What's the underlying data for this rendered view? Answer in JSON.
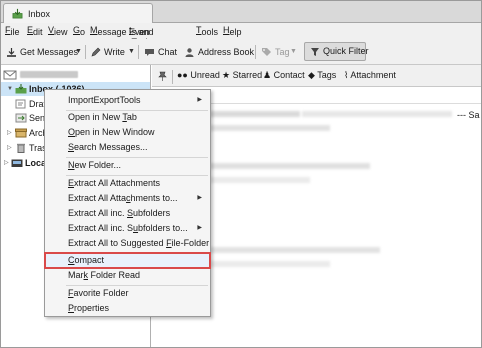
{
  "window": {
    "tab_title": "Inbox",
    "icon": "thunderbird-inbox-icon"
  },
  "menubar": {
    "items": [
      {
        "pre": "",
        "key": "F",
        "post": "ile"
      },
      {
        "pre": "",
        "key": "E",
        "post": "dit"
      },
      {
        "pre": "",
        "key": "V",
        "post": "iew"
      },
      {
        "pre": "",
        "key": "G",
        "post": "o"
      },
      {
        "pre": "",
        "key": "M",
        "post": "essage"
      },
      {
        "pre": "Even",
        "key": "t",
        "post": "s and Tasks"
      },
      {
        "pre": "",
        "key": "T",
        "post": "ools"
      },
      {
        "pre": "",
        "key": "H",
        "post": "elp"
      }
    ]
  },
  "toolbar": {
    "get_messages": "Get Messages",
    "write": "Write",
    "chat": "Chat",
    "address_book": "Address Book",
    "tag": "Tag",
    "quick_filter": "Quick Filter"
  },
  "folder_pane": {
    "inbox_label": "Inbox (-1036)",
    "folders": [
      {
        "label": "Draf"
      },
      {
        "label": "Sent"
      },
      {
        "label": "Arch"
      },
      {
        "label": "Tras"
      }
    ],
    "local_label": "Local"
  },
  "filter_bar": {
    "unread": "Unread",
    "starred": "Starred",
    "contact": "Contact",
    "tags": "Tags",
    "attachment": "Attachment"
  },
  "message_list": {
    "column_fragment": "t",
    "trailing_fragment": "--- Sa"
  },
  "context_menu": {
    "items": [
      {
        "pre": "ImportExportTools",
        "key": "",
        "post": "",
        "submenu": true
      },
      {
        "pre": "Open in New ",
        "key": "T",
        "post": "ab",
        "submenu": false
      },
      {
        "pre": "",
        "key": "O",
        "post": "pen in New Window",
        "submenu": false
      },
      {
        "pre": "",
        "key": "S",
        "post": "earch Messages...",
        "submenu": false
      },
      {
        "pre": "",
        "key": "N",
        "post": "ew Folder...",
        "submenu": false
      },
      {
        "pre": "",
        "key": "E",
        "post": "xtract All Attachments",
        "submenu": false
      },
      {
        "pre": "Extract All Atta",
        "key": "c",
        "post": "hments to...",
        "submenu": true
      },
      {
        "pre": "Extract All inc. ",
        "key": "S",
        "post": "ubfolders",
        "submenu": false
      },
      {
        "pre": "Extract All inc. S",
        "key": "u",
        "post": "bfolders to...",
        "submenu": true
      },
      {
        "pre": "Extract All to Suggested ",
        "key": "F",
        "post": "ile-Folder",
        "submenu": false
      },
      {
        "pre": "",
        "key": "C",
        "post": "ompact",
        "submenu": false
      },
      {
        "pre": "Mar",
        "key": "k",
        "post": " Folder Read",
        "submenu": false
      },
      {
        "pre": "",
        "key": "F",
        "post": "avorite Folder",
        "submenu": false
      },
      {
        "pre": "",
        "key": "P",
        "post": "roperties",
        "submenu": false
      }
    ]
  },
  "colors": {
    "selected_row": "#cce4f7",
    "highlight_outline": "#d94a4a",
    "menu_background": "#f5f5f5"
  }
}
